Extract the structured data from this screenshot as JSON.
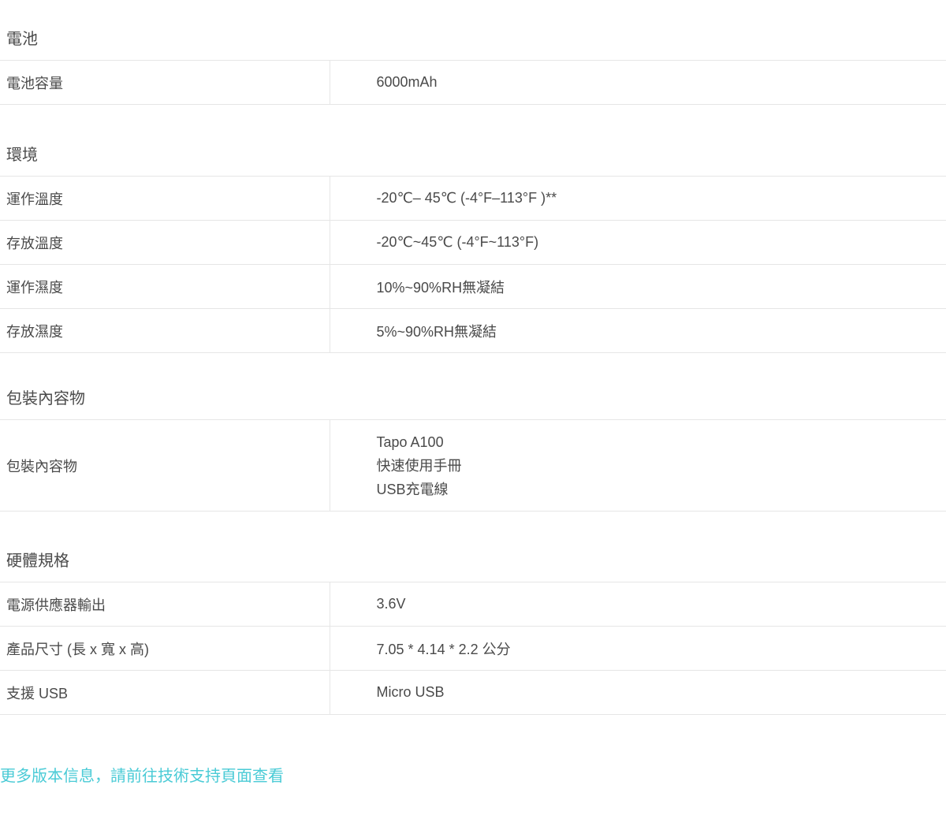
{
  "sections": [
    {
      "title": "電池",
      "rows": [
        {
          "label": "電池容量",
          "value": "6000mAh"
        }
      ]
    },
    {
      "title": "環境",
      "rows": [
        {
          "label": "運作溫度",
          "value": "-20℃– 45℃ (-4°F–113°F )**"
        },
        {
          "label": "存放溫度",
          "value": "-20℃~45℃ (-4°F~113°F)"
        },
        {
          "label": "運作濕度",
          "value": "10%~90%RH無凝結"
        },
        {
          "label": "存放濕度",
          "value": "5%~90%RH無凝結"
        }
      ]
    },
    {
      "title": "包裝內容物",
      "rows": [
        {
          "label": "包裝內容物",
          "values": [
            "Tapo A100",
            "快速使用手冊",
            "USB充電線"
          ]
        }
      ]
    },
    {
      "title": "硬體規格",
      "rows": [
        {
          "label": "電源供應器輸出",
          "value": "3.6V"
        },
        {
          "label": "產品尺寸 (長 x 寬 x 高)",
          "value": "7.05 * 4.14 * 2.2 公分"
        },
        {
          "label": "支援 USB",
          "value": "Micro USB"
        }
      ]
    }
  ],
  "footer": {
    "link_text": "更多版本信息，請前往技術支持頁面查看",
    "link_color": "#4acbd6"
  }
}
